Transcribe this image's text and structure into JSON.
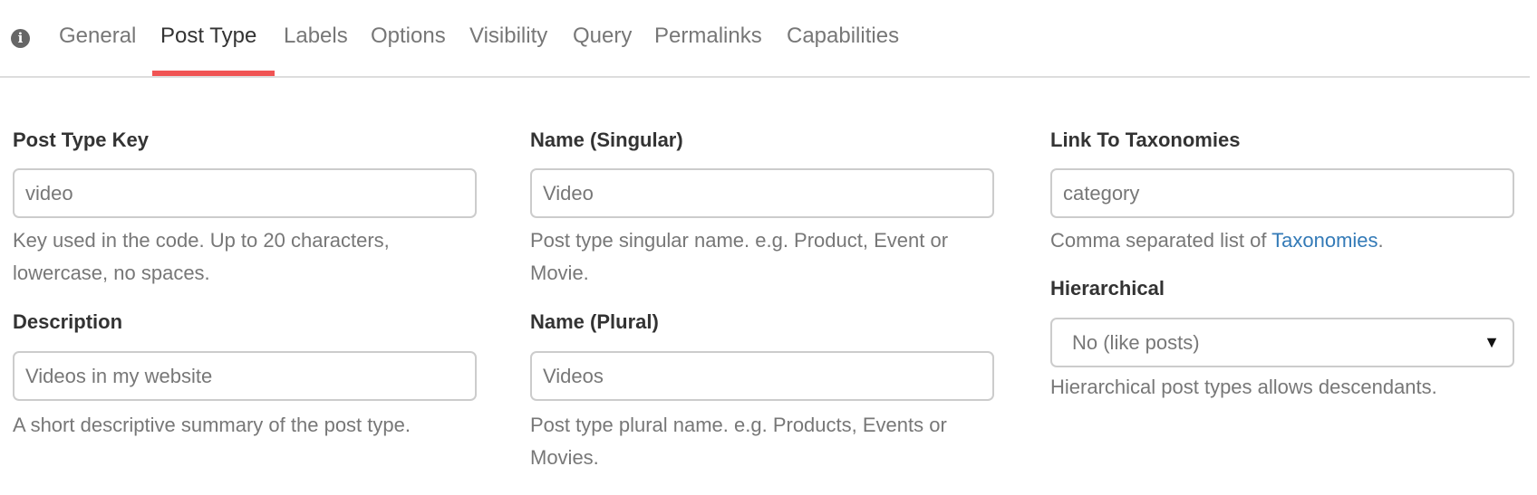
{
  "tabs": {
    "info_icon": "info-circle-icon",
    "items": [
      "General",
      "Post Type",
      "Labels",
      "Options",
      "Visibility",
      "Query",
      "Permalinks",
      "Capabilities"
    ],
    "active": "Post Type",
    "active_color": "#f05454"
  },
  "fields": {
    "post_type_key": {
      "label": "Post Type Key",
      "value": "video",
      "help": "Key used in the code. Up to 20 characters, lowercase, no spaces."
    },
    "description": {
      "label": "Description",
      "value": "Videos in my website",
      "help": "A short descriptive summary of the post type."
    },
    "name_singular": {
      "label": "Name (Singular)",
      "value": "Video",
      "help": "Post type singular name. e.g. Product, Event or Movie."
    },
    "name_plural": {
      "label": "Name (Plural)",
      "value": "Videos",
      "help": "Post type plural name. e.g. Products, Events or Movies."
    },
    "taxonomies": {
      "label": "Link To Taxonomies",
      "value": "category",
      "help_prefix": "Comma separated list of ",
      "help_link": "Taxonomies",
      "help_suffix": ".",
      "link_color": "#337ab7"
    },
    "hierarchical": {
      "label": "Hierarchical",
      "value": "No (like posts)",
      "help": "Hierarchical post types allows descendants."
    }
  }
}
